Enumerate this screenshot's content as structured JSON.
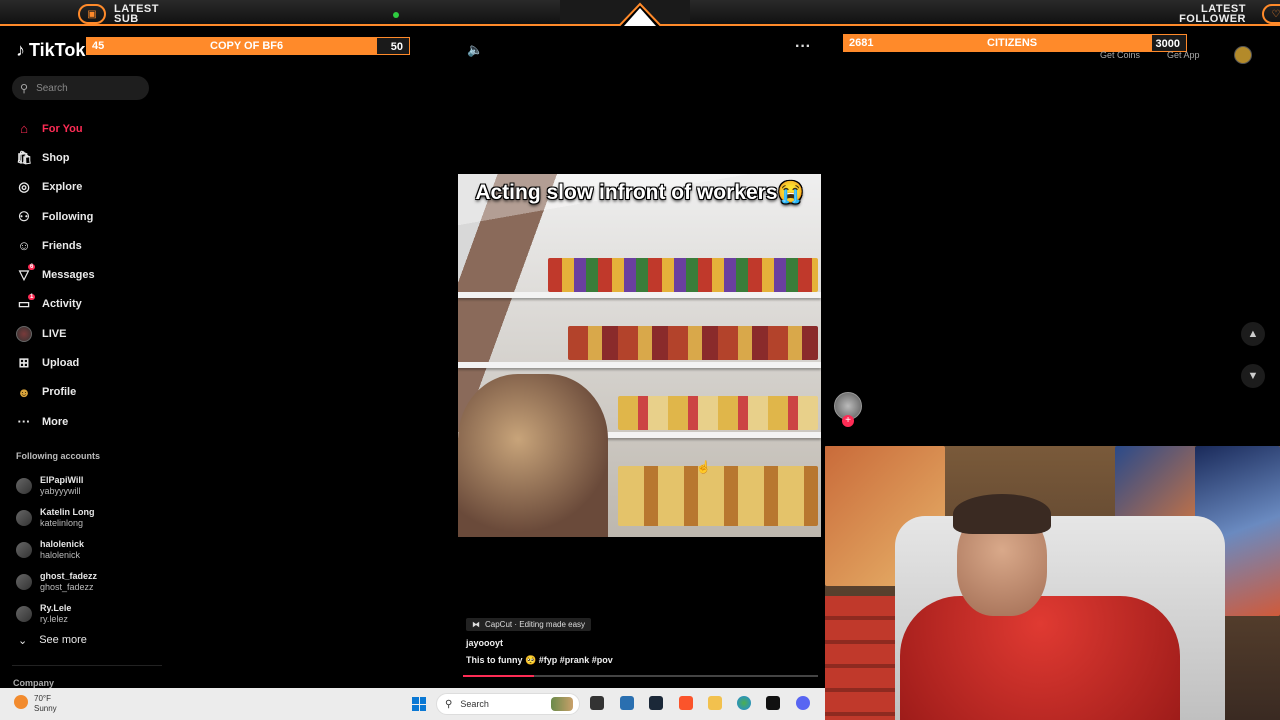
{
  "overlay": {
    "left_label_line1": "LATEST",
    "left_label_line2": "SUB",
    "right_label_line1": "LATEST",
    "right_label_line2": "FOLLOWER",
    "sub_goal": {
      "current": "45",
      "title": "COPY OF BF6",
      "target": "50",
      "progress_fraction": 0.9
    },
    "follower_goal": {
      "current": "2681",
      "title": "CITIZENS",
      "target": "3000",
      "progress_fraction": 0.89
    },
    "accent_color": "#ff8a2a"
  },
  "tiktok": {
    "logo_text": "TikTok",
    "search_placeholder": "Search",
    "accent_color": "#fe2c55",
    "nav": [
      {
        "label": "For You",
        "icon": "home-icon",
        "active": true
      },
      {
        "label": "Shop",
        "icon": "shop-icon"
      },
      {
        "label": "Explore",
        "icon": "compass-icon"
      },
      {
        "label": "Following",
        "icon": "following-icon"
      },
      {
        "label": "Friends",
        "icon": "friends-icon"
      },
      {
        "label": "Messages",
        "icon": "messages-icon",
        "badge": "6"
      },
      {
        "label": "Activity",
        "icon": "activity-icon",
        "badge": "1"
      },
      {
        "label": "LIVE",
        "icon": "live-icon"
      },
      {
        "label": "Upload",
        "icon": "upload-icon"
      },
      {
        "label": "Profile",
        "icon": "profile-icon"
      },
      {
        "label": "More",
        "icon": "more-icon"
      }
    ],
    "following_title": "Following accounts",
    "following": [
      {
        "name": "ElPapiWill",
        "username": "yabyyywill"
      },
      {
        "name": "Katelin Long",
        "username": "katelinlong"
      },
      {
        "name": "halolenick",
        "username": "halolenick"
      },
      {
        "name": "ghost_fadezz",
        "username": "ghost_fadezz"
      },
      {
        "name": "Ry.Lele",
        "username": "ry.lelez"
      }
    ],
    "see_more": "See more",
    "company": "Company",
    "get_coins": "Get Coins",
    "get_app": "Get App",
    "video": {
      "caption": "Acting slow infront of workers😭",
      "capcut": "CapCut · Editing made easy",
      "author": "jayoooyt",
      "description": "This to funny 🥺 #fyp  #prank  #pov",
      "progress_fraction": 0.2
    }
  },
  "taskbar": {
    "weather_temp": "70°F",
    "weather_desc": "Sunny",
    "search_label": "Search"
  }
}
